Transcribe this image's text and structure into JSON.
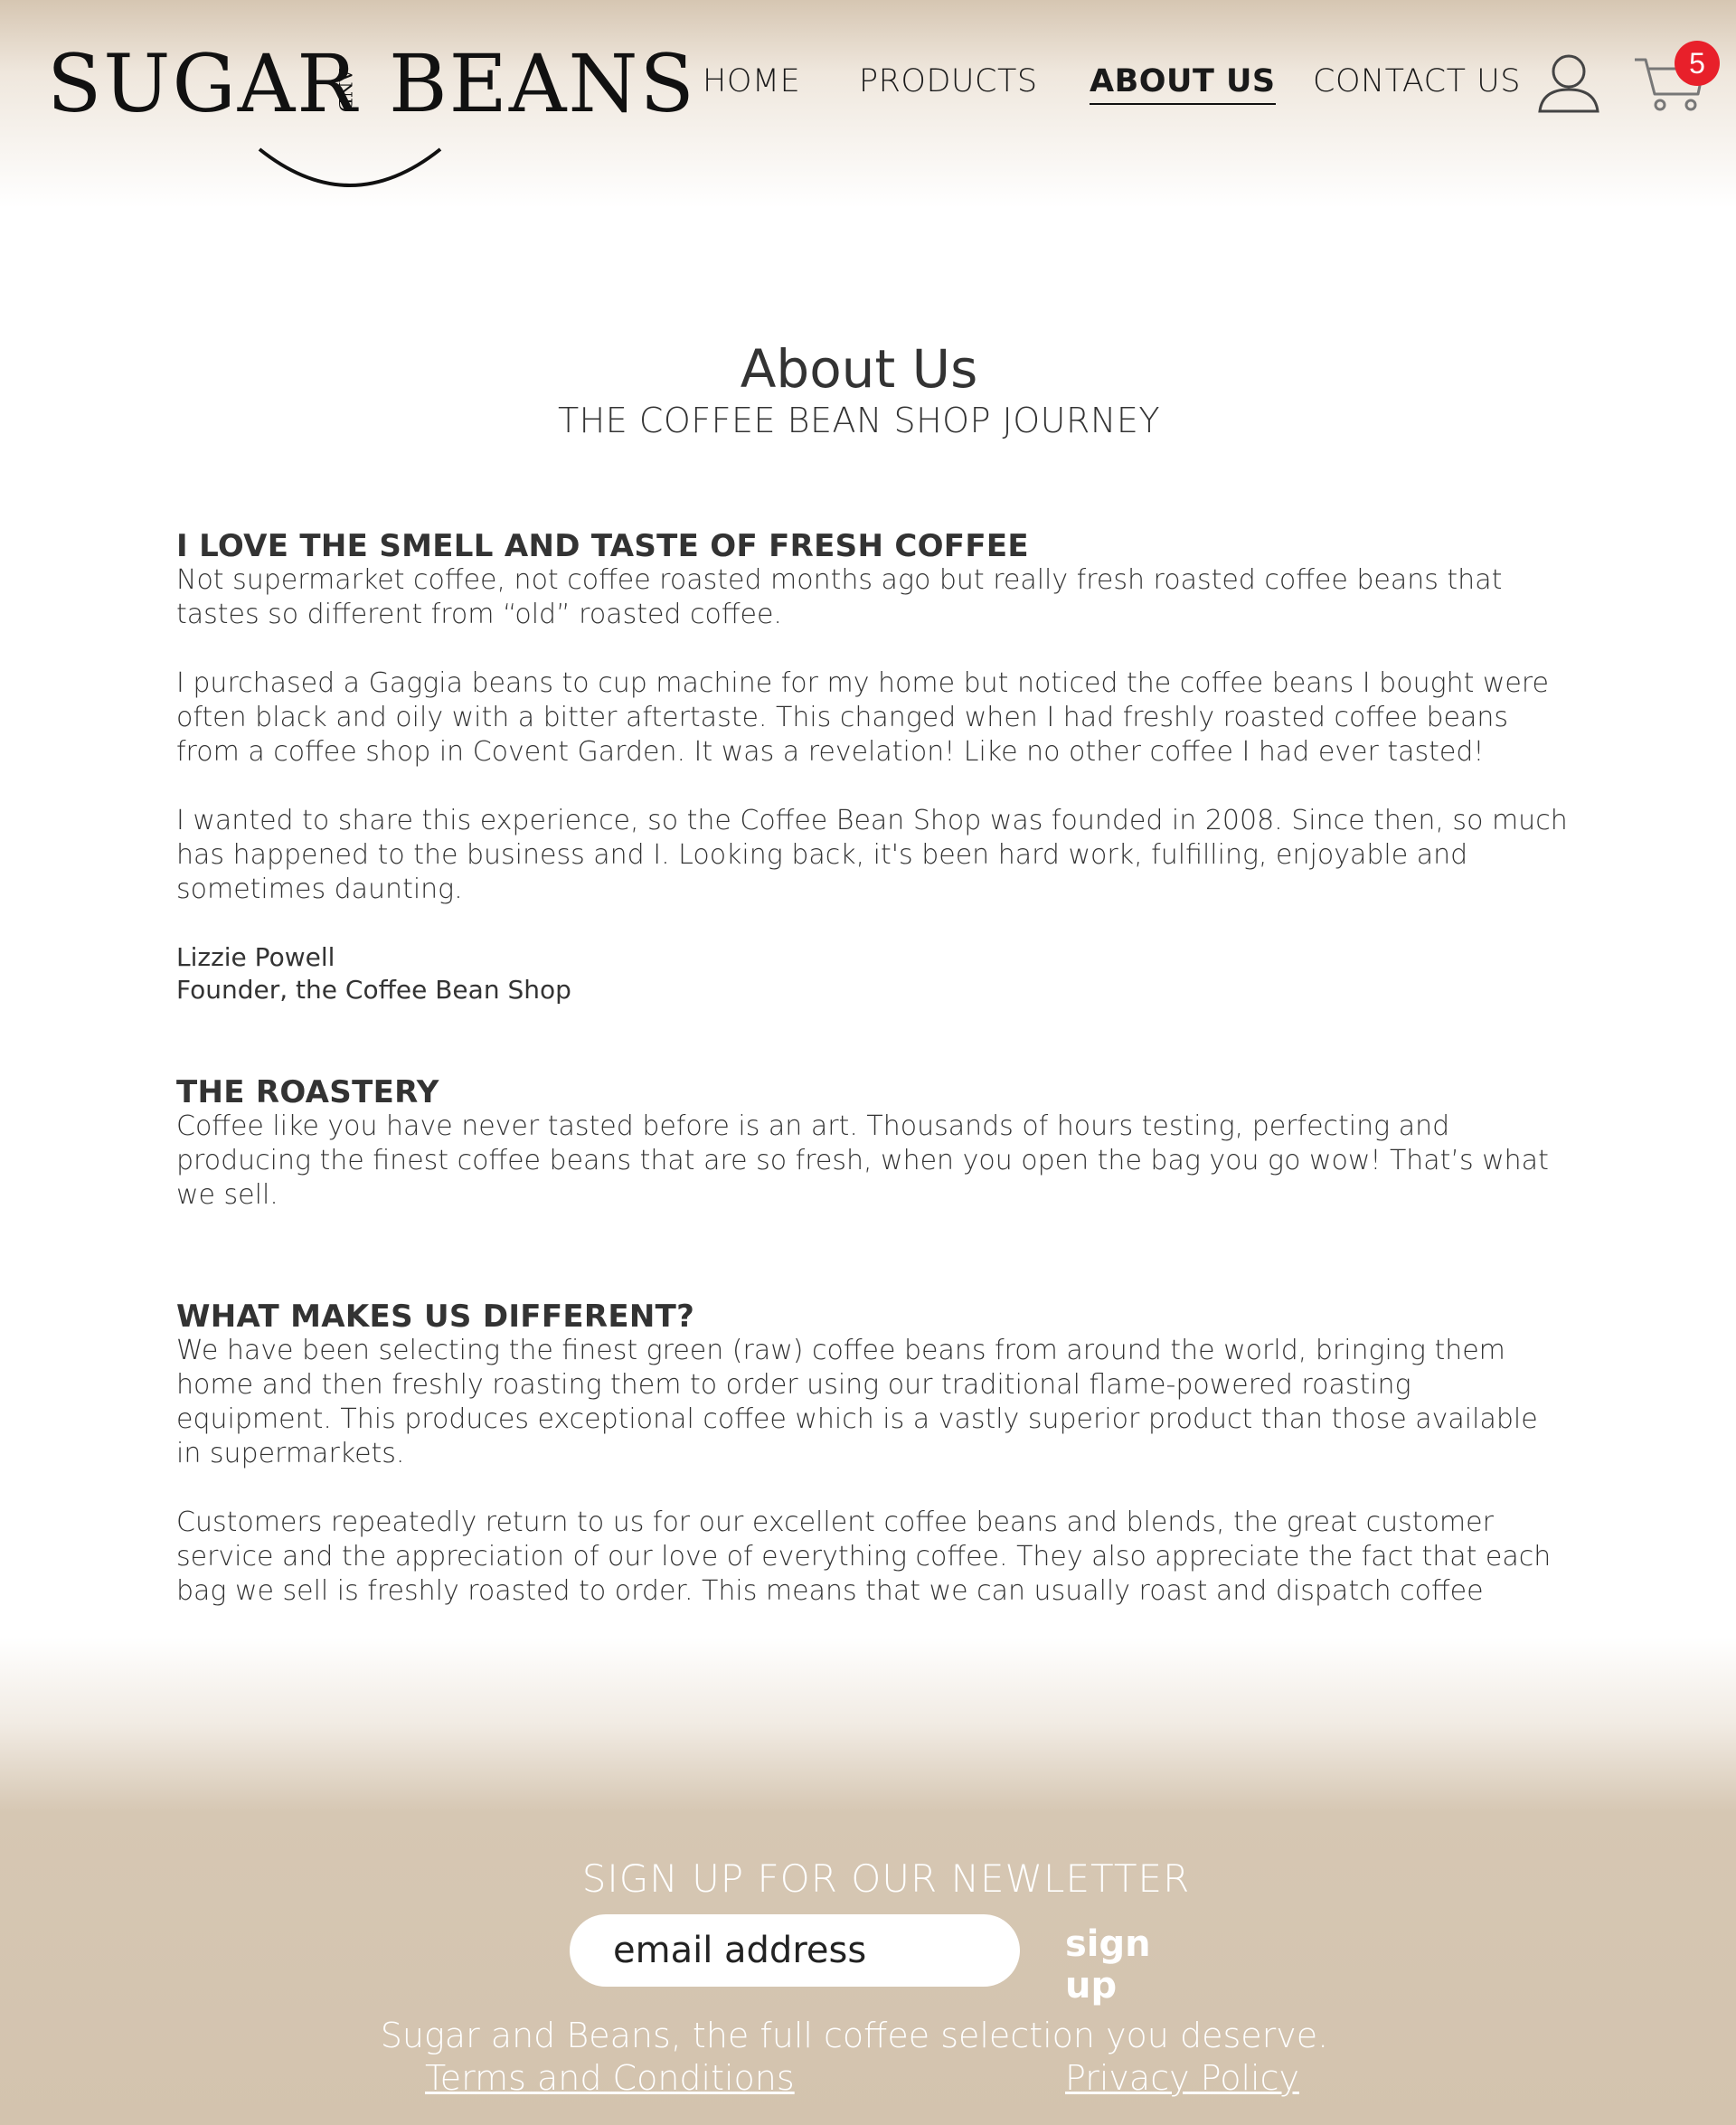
{
  "brand": {
    "word1": "SUGAR",
    "and": "AND",
    "word2": "BEANS"
  },
  "nav": {
    "home": "HOME",
    "products": "PRODUCTS",
    "about": "ABOUT US",
    "contact": "CONTACT US"
  },
  "icons": {
    "account": "user-icon",
    "cart": "shopping-cart-icon"
  },
  "cart": {
    "count": "5",
    "badge_color": "#e8202a"
  },
  "colors": {
    "accent": "#d3c3ae",
    "text": "#333333"
  },
  "page": {
    "title": "About Us",
    "subtitle": "THE COFFEE BEAN SHOP JOURNEY"
  },
  "sections": [
    {
      "heading": "I LOVE THE SMELL AND TASTE OF FRESH COFFEE",
      "paragraphs": [
        "Not supermarket coffee, not coffee roasted months ago but really fresh roasted coffee beans that tastes so different from “old” roasted coffee.",
        "I purchased a Gaggia beans to cup machine for my home but noticed the coffee beans I bought were often black and oily with a bitter aftertaste. This changed when I had freshly roasted coffee beans from a coffee shop in Covent Garden. It was a revelation! Like no other coffee I had ever tasted!",
        "I wanted to share this experience, so the Coffee Bean Shop was founded in 2008. Since then, so much has happened to the business and I. Looking back, it's been hard work, fulfilling, enjoyable and sometimes daunting."
      ],
      "signature": {
        "name": "Lizzie Powell",
        "title": "Founder, the Coffee Bean Shop"
      }
    },
    {
      "heading": "THE ROASTERY",
      "paragraphs": [
        "Coffee like you have never tasted before is an art. Thousands of hours testing, perfecting and producing the finest coffee beans that are so fresh, when you open the bag you go wow! That’s what we sell."
      ]
    },
    {
      "heading": "WHAT MAKES US DIFFERENT?",
      "paragraphs": [
        "We have been selecting the finest green (raw) coffee beans from around the world, bringing them home and then freshly roasting them to order using our traditional flame-powered roasting equipment. This produces exceptional coffee which is a vastly superior product than those available in supermarkets.",
        "Customers repeatedly return to us for our excellent coffee beans and blends, the great customer service and the appreciation of our love of everything coffee. They also appreciate the fact that each bag we sell is freshly roasted to order.  This means that we can usually roast and dispatch coffee"
      ]
    }
  ],
  "footer": {
    "newsletter_title": "SIGN UP FOR OUR NEWLETTER",
    "email_placeholder": "email address",
    "signup_label": "sign up",
    "tagline": "Sugar and Beans, the full coffee selection you deserve.",
    "terms": "Terms and Conditions",
    "privacy": "Privacy Policy"
  }
}
